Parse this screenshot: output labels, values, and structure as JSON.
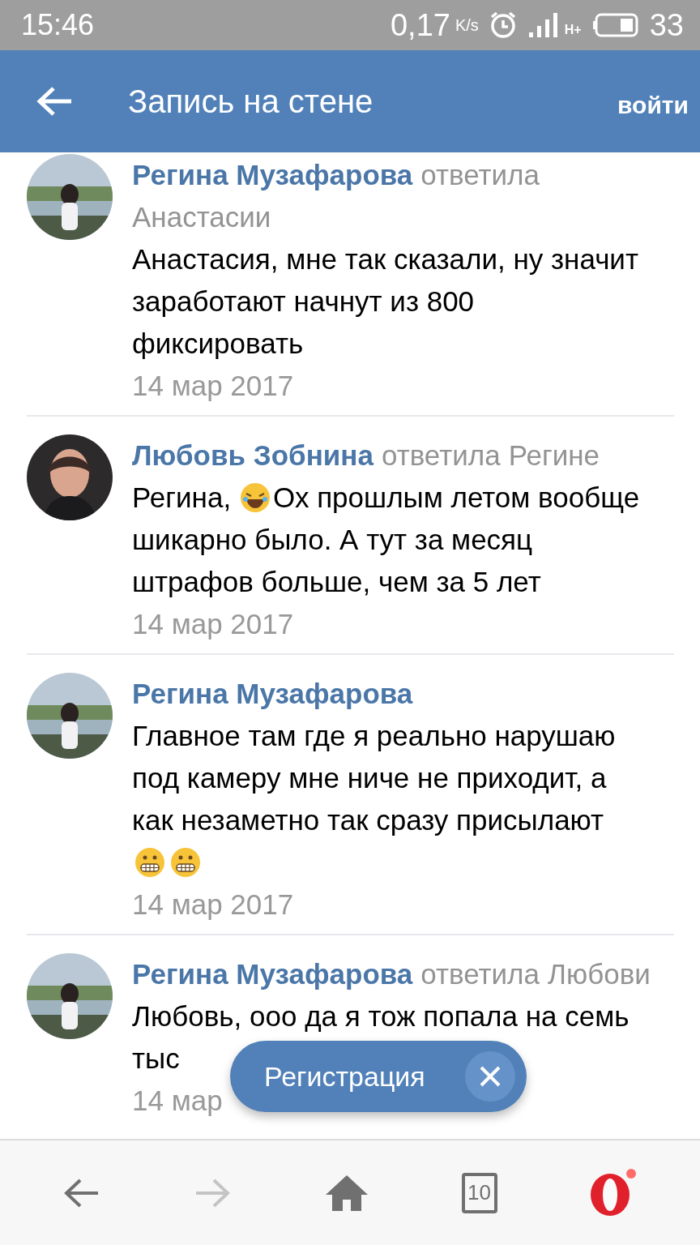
{
  "status_bar": {
    "time": "15:46",
    "speed": "0,17",
    "speed_unit": "K/s",
    "network": "H+",
    "battery": "33"
  },
  "header": {
    "title": "Запись на стене",
    "login": "войти"
  },
  "comments": [
    {
      "author": "Регина Музафарова",
      "reply": "ответила",
      "reply_to": "Анастасии",
      "lines": [
        [
          {
            "kind": "text",
            "text": "Анастасия, мне так сказали, ну значит"
          }
        ],
        [
          {
            "kind": "text",
            "text": "заработают начнут из 800"
          }
        ],
        [
          {
            "kind": "text",
            "text": "фиксировать"
          }
        ]
      ],
      "date": "14 мар 2017"
    },
    {
      "author": "Любовь Зобнина",
      "reply": "ответила",
      "reply_to": "Регине",
      "lines": [
        [
          {
            "kind": "text",
            "text": "Регина,"
          },
          {
            "kind": "laugh"
          },
          {
            "kind": "text",
            "text": "Ох прошлым летом вообще"
          }
        ],
        [
          {
            "kind": "text",
            "text": "шикарно было. А тут за месяц"
          }
        ],
        [
          {
            "kind": "text",
            "text": "штрафов больше, чем за 5 лет"
          }
        ]
      ],
      "date": "14 мар 2017"
    },
    {
      "author": "Регина Музафарова",
      "lines": [
        [
          {
            "kind": "text",
            "text": "Главное там где я реально нарушаю"
          }
        ],
        [
          {
            "kind": "text",
            "text": "под камеру мне ниче не приходит, а"
          }
        ],
        [
          {
            "kind": "text",
            "text": "как незаметно так сразу присылают"
          }
        ],
        [
          {
            "kind": "grin"
          },
          {
            "kind": "grin"
          }
        ]
      ],
      "date": "14 мар 2017"
    },
    {
      "author": "Регина Музафарова",
      "reply": "ответила",
      "reply_to": "Любови",
      "lines": [
        [
          {
            "kind": "text",
            "text": "Любовь, ооо да я тож попала на семь"
          }
        ],
        [
          {
            "kind": "text",
            "text": "тыс"
          }
        ]
      ],
      "date": "14 мар"
    }
  ],
  "register_button": {
    "label": "Регистрация"
  },
  "bottom_nav": {
    "forward_disabled": true,
    "tabs_count": "10",
    "notification": true
  }
}
